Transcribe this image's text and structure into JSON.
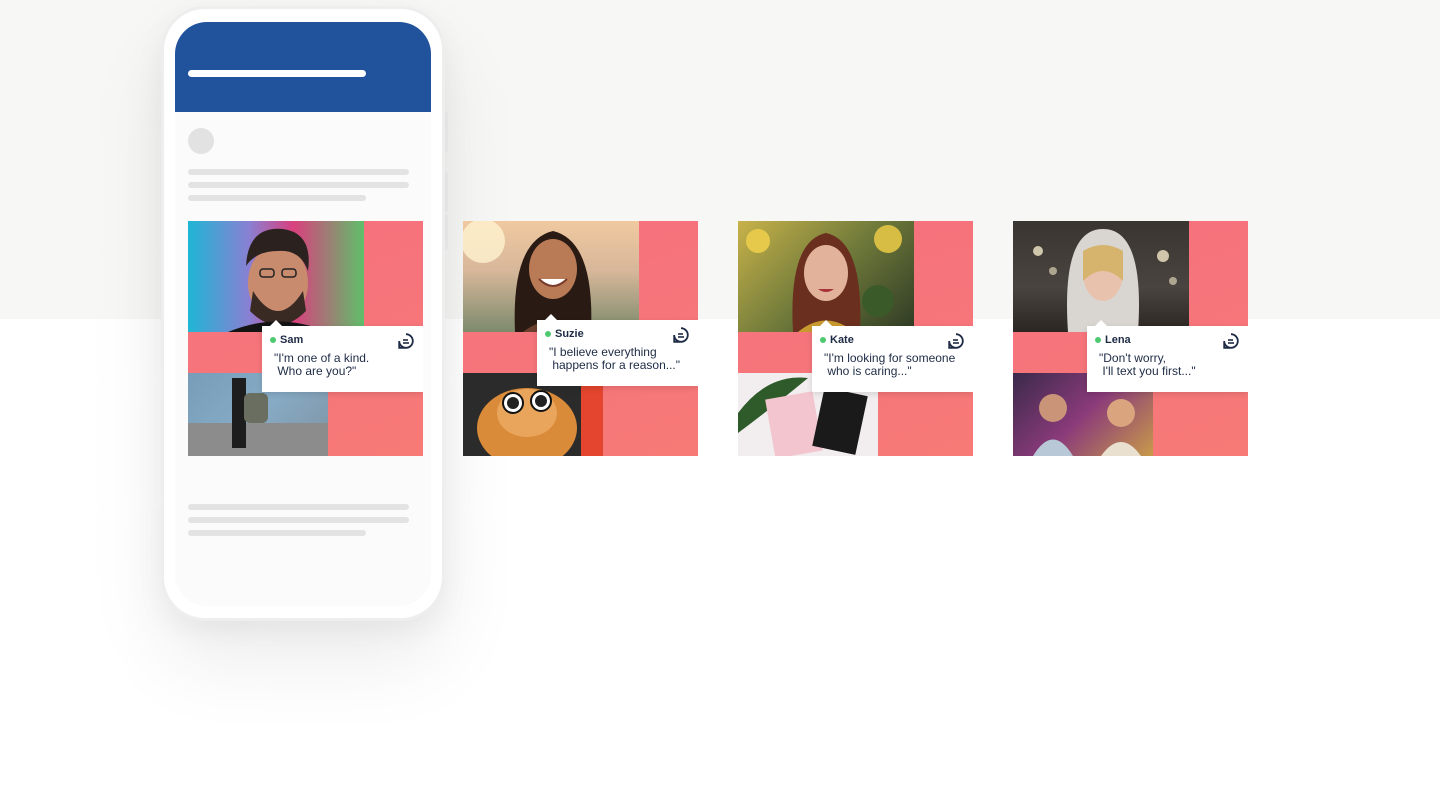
{
  "colors": {
    "top_background": "#f7f7f5",
    "phone_header": "#21529c",
    "card_pink": "#f6737f",
    "online": "#4fc970",
    "text_dark": "#1e2b45"
  },
  "cards": [
    {
      "name": "Sam",
      "quote": "\"I'm one of a kind.\n Who are you?\""
    },
    {
      "name": "Suzie",
      "quote": "\"I believe everything\n happens for a reason...\""
    },
    {
      "name": "Kate",
      "quote": "\"I'm looking for someone\n who is caring...\""
    },
    {
      "name": "Lena",
      "quote": "\"Don't worry,\n I'll text you first...\""
    }
  ],
  "icons": {
    "chat": "chat-bubble-icon",
    "online": "online-status-dot"
  }
}
